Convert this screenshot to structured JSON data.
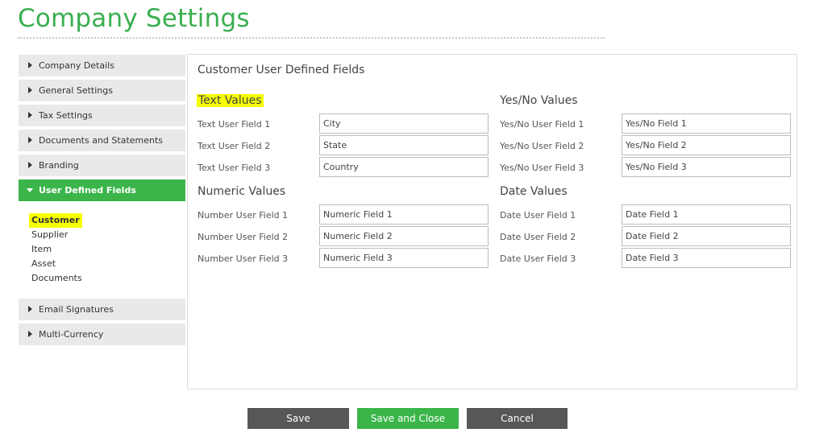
{
  "page": {
    "title": "Company Settings"
  },
  "sidebar": {
    "items": [
      {
        "label": "Company Details"
      },
      {
        "label": "General Settings"
      },
      {
        "label": "Tax Settings"
      },
      {
        "label": "Documents and Statements"
      },
      {
        "label": "Branding"
      },
      {
        "label": "User Defined Fields"
      },
      {
        "label": "Email Signatures"
      },
      {
        "label": "Multi-Currency"
      }
    ],
    "active": "User Defined Fields",
    "sub_items": [
      {
        "label": "Customer"
      },
      {
        "label": "Supplier"
      },
      {
        "label": "Item"
      },
      {
        "label": "Asset"
      },
      {
        "label": "Documents"
      }
    ],
    "selected_sub": "Customer"
  },
  "main": {
    "title": "Customer User Defined Fields",
    "groups": {
      "text": {
        "heading": "Text Values",
        "fields": [
          {
            "label": "Text User Field 1",
            "value": "City"
          },
          {
            "label": "Text User Field 2",
            "value": "State"
          },
          {
            "label": "Text User Field 3",
            "value": "Country"
          }
        ]
      },
      "yesno": {
        "heading": "Yes/No Values",
        "fields": [
          {
            "label": "Yes/No User Field 1",
            "value": "Yes/No Field 1"
          },
          {
            "label": "Yes/No User Field 2",
            "value": "Yes/No Field 2"
          },
          {
            "label": "Yes/No User Field 3",
            "value": "Yes/No Field 3"
          }
        ]
      },
      "numeric": {
        "heading": "Numeric Values",
        "fields": [
          {
            "label": "Number User Field 1",
            "value": "Numeric Field 1"
          },
          {
            "label": "Number User Field 2",
            "value": "Numeric Field 2"
          },
          {
            "label": "Number User Field 3",
            "value": "Numeric Field 3"
          }
        ]
      },
      "date": {
        "heading": "Date Values",
        "fields": [
          {
            "label": "Date User Field 1",
            "value": "Date Field 1"
          },
          {
            "label": "Date User Field 2",
            "value": "Date Field 2"
          },
          {
            "label": "Date User Field 3",
            "value": "Date Field 3"
          }
        ]
      }
    }
  },
  "actions": {
    "save": "Save",
    "save_close": "Save and Close",
    "cancel": "Cancel"
  },
  "colors": {
    "brand_green": "#3bb54a",
    "highlight_yellow": "#f6ff00",
    "button_dark": "#575757"
  },
  "icons": {
    "collapsed": "triangle-right-icon",
    "expanded": "triangle-down-icon"
  }
}
